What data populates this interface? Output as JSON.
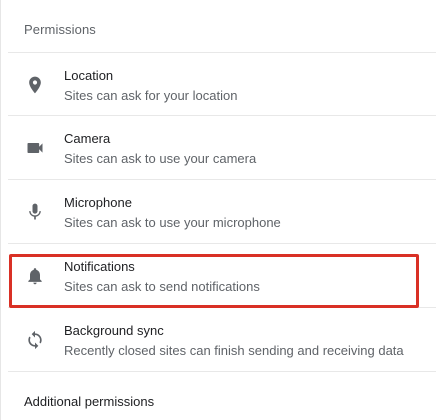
{
  "section_title": "Permissions",
  "items": [
    {
      "icon": "location-pin-icon",
      "label": "Location",
      "desc": "Sites can ask for your location"
    },
    {
      "icon": "camera-icon",
      "label": "Camera",
      "desc": "Sites can ask to use your camera"
    },
    {
      "icon": "microphone-icon",
      "label": "Microphone",
      "desc": "Sites can ask to use your microphone"
    },
    {
      "icon": "bell-icon",
      "label": "Notifications",
      "desc": "Sites can ask to send notifications"
    },
    {
      "icon": "sync-icon",
      "label": "Background sync",
      "desc": "Recently closed sites can finish sending and receiving data"
    }
  ],
  "highlight_color": "#d93025",
  "additional_title": "Additional permissions"
}
